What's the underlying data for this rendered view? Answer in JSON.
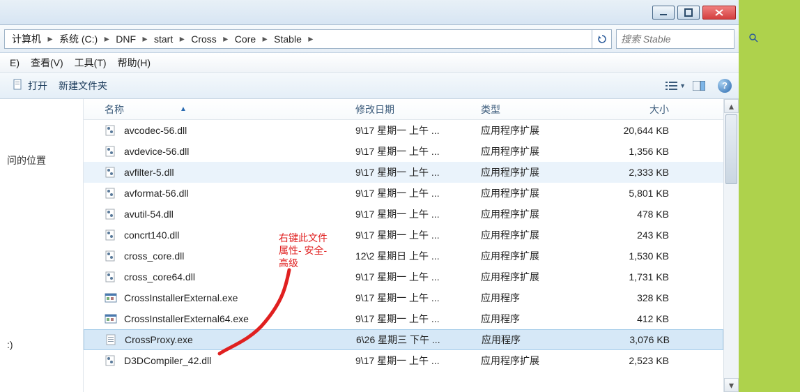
{
  "window_controls": {
    "minimize": "min",
    "maximize": "max",
    "close": "close"
  },
  "breadcrumb": [
    "计算机",
    "系统 (C:)",
    "DNF",
    "start",
    "Cross",
    "Core",
    "Stable"
  ],
  "search": {
    "placeholder": "搜索 Stable"
  },
  "menus": [
    "E)",
    "查看(V)",
    "工具(T)",
    "帮助(H)"
  ],
  "toolbar": {
    "open": "打开",
    "newfolder": "新建文件夹"
  },
  "sidebar": {
    "recent": "问的位置"
  },
  "columns": {
    "name": "名称",
    "date": "修改日期",
    "type": "类型",
    "size": "大小"
  },
  "files": [
    {
      "name": "avcodec-56.dll",
      "date": "9\\17 星期一 上午 ...",
      "type": "应用程序扩展",
      "size": "20,644 KB",
      "icon": "dll",
      "sel": ""
    },
    {
      "name": "avdevice-56.dll",
      "date": "9\\17 星期一 上午 ...",
      "type": "应用程序扩展",
      "size": "1,356 KB",
      "icon": "dll",
      "sel": ""
    },
    {
      "name": "avfilter-5.dll",
      "date": "9\\17 星期一 上午 ...",
      "type": "应用程序扩展",
      "size": "2,333 KB",
      "icon": "dll",
      "sel": "highlight"
    },
    {
      "name": "avformat-56.dll",
      "date": "9\\17 星期一 上午 ...",
      "type": "应用程序扩展",
      "size": "5,801 KB",
      "icon": "dll",
      "sel": ""
    },
    {
      "name": "avutil-54.dll",
      "date": "9\\17 星期一 上午 ...",
      "type": "应用程序扩展",
      "size": "478 KB",
      "icon": "dll",
      "sel": ""
    },
    {
      "name": "concrt140.dll",
      "date": "9\\17 星期一 上午 ...",
      "type": "应用程序扩展",
      "size": "243 KB",
      "icon": "dll",
      "sel": ""
    },
    {
      "name": "cross_core.dll",
      "date": "12\\2 星期日 上午 ...",
      "type": "应用程序扩展",
      "size": "1,530 KB",
      "icon": "dll",
      "sel": ""
    },
    {
      "name": "cross_core64.dll",
      "date": "9\\17 星期一 上午 ...",
      "type": "应用程序扩展",
      "size": "1,731 KB",
      "icon": "dll",
      "sel": ""
    },
    {
      "name": "CrossInstallerExternal.exe",
      "date": "9\\17 星期一 上午 ...",
      "type": "应用程序",
      "size": "328 KB",
      "icon": "exe",
      "sel": ""
    },
    {
      "name": "CrossInstallerExternal64.exe",
      "date": "9\\17 星期一 上午 ...",
      "type": "应用程序",
      "size": "412 KB",
      "icon": "exe",
      "sel": ""
    },
    {
      "name": "CrossProxy.exe",
      "date": "6\\26 星期三 下午 ...",
      "type": "应用程序",
      "size": "3,076 KB",
      "icon": "exe2",
      "sel": "selected"
    },
    {
      "name": "D3DCompiler_42.dll",
      "date": "9\\17 星期一 上午 ...",
      "type": "应用程序扩展",
      "size": "2,523 KB",
      "icon": "dll",
      "sel": ""
    }
  ],
  "annotation": {
    "line1": "右键此文件",
    "line2": "属性-  安全-",
    "line3": "高级"
  }
}
